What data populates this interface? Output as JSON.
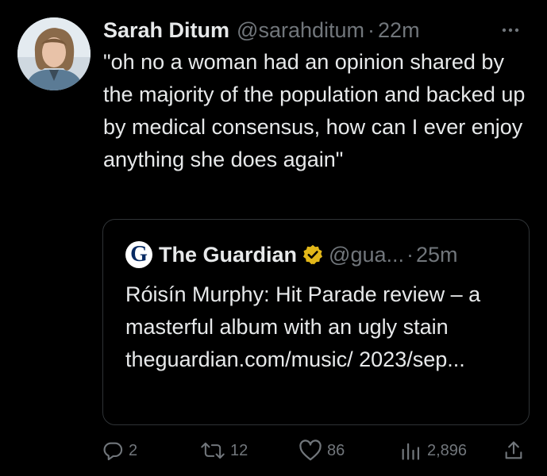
{
  "tweet": {
    "display_name": "Sarah Ditum",
    "handle": "@sarahditum",
    "separator": "·",
    "time": "22m",
    "text": "\"oh no a woman had an opinion shared by the majority of the population and backed up by medical consensus, how can I ever enjoy anything she does again\""
  },
  "quote": {
    "display_name": "The Guardian",
    "handle": "@gua...",
    "separator": "·",
    "time": "25m",
    "logo_letter": "G",
    "text": "Róisín Murphy: Hit Parade review – a masterful album with an ugly stain theguardian.com/music/ 2023/sep..."
  },
  "actions": {
    "replies": "2",
    "retweets": "12",
    "likes": "86",
    "views": "2,896"
  },
  "icons": {
    "more": "more-horizontal-icon",
    "reply": "reply-icon",
    "retweet": "retweet-icon",
    "like": "heart-icon",
    "views": "views-icon",
    "share": "share-icon",
    "verified": "verified-badge-icon"
  },
  "colors": {
    "background": "#000000",
    "text": "#e7e9ea",
    "muted": "#71767b",
    "border": "#2f3336",
    "verified_gold": "#e2b719",
    "guardian_navy": "#052962"
  }
}
